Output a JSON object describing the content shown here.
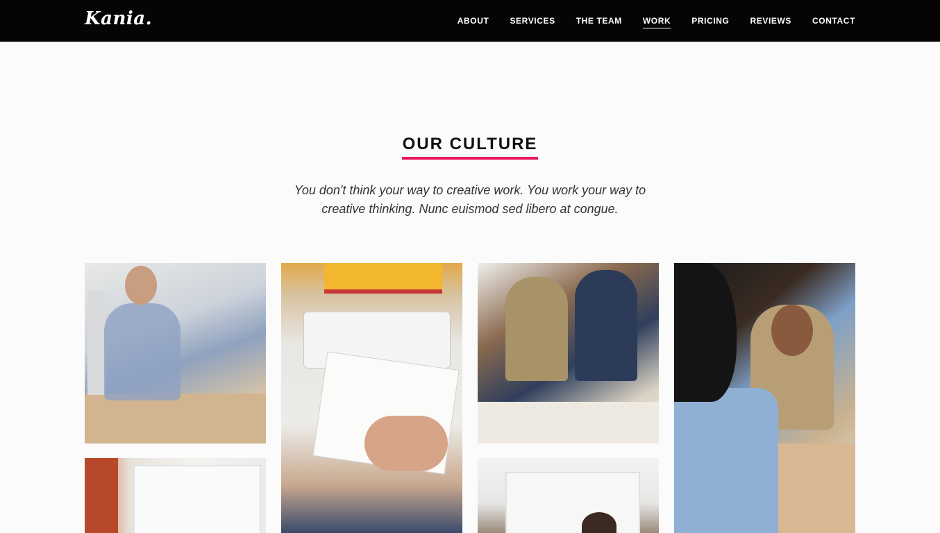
{
  "brand": {
    "logo_text": "Kania."
  },
  "nav": {
    "items": [
      {
        "label": "ABOUT",
        "active": false
      },
      {
        "label": "SERVICES",
        "active": false
      },
      {
        "label": "THE TEAM",
        "active": false
      },
      {
        "label": "WORK",
        "active": true
      },
      {
        "label": "PRICING",
        "active": false
      },
      {
        "label": "REVIEWS",
        "active": false
      },
      {
        "label": "CONTACT",
        "active": false
      }
    ]
  },
  "culture": {
    "title": "OUR CULTURE",
    "subtitle": "You don't think your way to creative work. You work your way to creative thinking. Nunc euismod sed libero at congue."
  },
  "colors": {
    "navbar_bg": "#050505",
    "accent": "#e8185a",
    "page_bg": "#fbfbfc",
    "text": "#111111"
  }
}
